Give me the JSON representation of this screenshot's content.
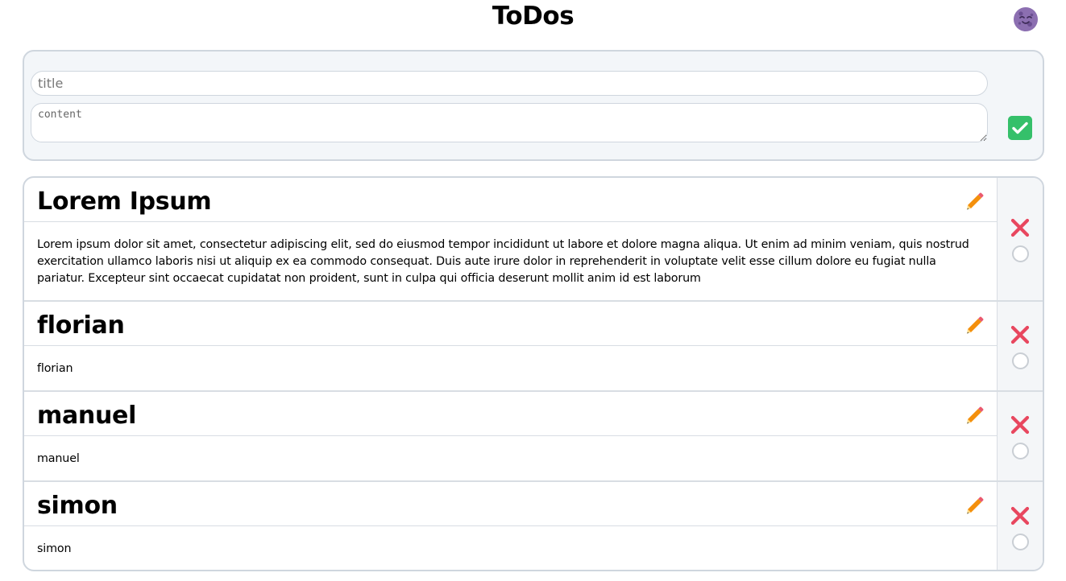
{
  "header": {
    "title": "ToDos",
    "theme_icon": "moon-face-icon"
  },
  "create_form": {
    "title_placeholder": "title",
    "title_value": "",
    "content_placeholder": "content",
    "content_value": "",
    "submit_icon": "check-icon",
    "submit_color": "#35c06a"
  },
  "todos": [
    {
      "title": "Lorem Ipsum",
      "content": "Lorem ipsum dolor sit amet, consectetur adipiscing elit, sed do eiusmod tempor incididunt ut labore et dolore magna aliqua. Ut enim ad minim veniam, quis nostrud exercitation ullamco laboris nisi ut aliquip ex ea commodo consequat. Duis aute irure dolor in reprehenderit in voluptate velit esse cillum dolore eu fugiat nulla pariatur. Excepteur sint occaecat cupidatat non proident, sunt in culpa qui officia deserunt mollit anim id est laborum",
      "done": false
    },
    {
      "title": "florian",
      "content": "florian",
      "done": false
    },
    {
      "title": "manuel",
      "content": "manuel",
      "done": false
    },
    {
      "title": "simon",
      "content": "simon",
      "done": false
    }
  ],
  "icons": {
    "edit": "pencil-icon",
    "delete": "cross-icon",
    "done": "circle-checkbox"
  },
  "colors": {
    "delete": "#e8475f",
    "edit": "#f4900c",
    "panel_bg": "#f3f6f9",
    "border": "#cfd6de"
  }
}
